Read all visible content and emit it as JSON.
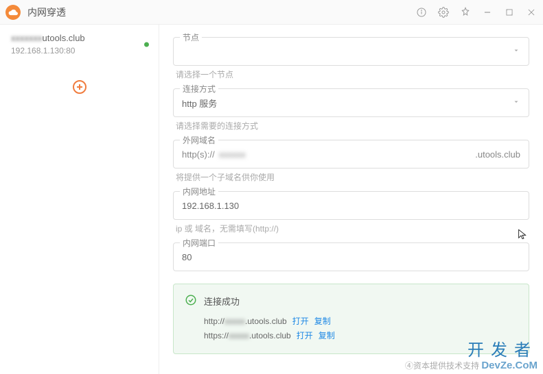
{
  "titlebar": {
    "title": "内网穿透"
  },
  "sidebar": {
    "tunnel": {
      "host_suffix": "utools.club",
      "address": "192.168.1.130:80"
    }
  },
  "form": {
    "node": {
      "label": "节点",
      "value": "",
      "helper": "请选择一个节点"
    },
    "conn_type": {
      "label": "连接方式",
      "value": "http 服务",
      "helper": "请选择需要的连接方式"
    },
    "domain": {
      "label": "外网域名",
      "prefix": "http(s)://",
      "value": "xxxxxx",
      "suffix": ".utools.club",
      "helper": "将提供一个子域名供你使用"
    },
    "lan_addr": {
      "label": "内网地址",
      "value": "192.168.1.130",
      "helper": "ip 或 域名，无需填写(http://)"
    },
    "lan_port": {
      "label": "内网端口",
      "value": "80"
    }
  },
  "success": {
    "title": "连接成功",
    "rows": [
      {
        "scheme": "http://",
        "mid": "xxxxx",
        "suffix": ".utools.club",
        "open": "打开",
        "copy": "复制"
      },
      {
        "scheme": "https://",
        "mid": "xxxxx",
        "suffix": ".utools.club",
        "open": "打开",
        "copy": "复制"
      }
    ]
  },
  "watermark": {
    "line1": "开发者",
    "line2a": "④资本提供技术支持",
    "line2b": "DevZe.CoM"
  }
}
